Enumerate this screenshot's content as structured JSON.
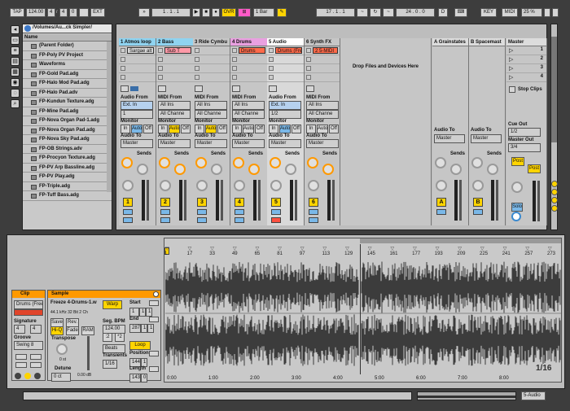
{
  "transport": {
    "tap": "TAP",
    "tempo": "124.00",
    "sig_num": "4",
    "sig_den": "4",
    "metro": "0",
    "ext": "EXT",
    "position": "1 . 1 . 1",
    "ovr": "OVR",
    "quant": "1 Bar",
    "loop_start": "17 . 1 . 1",
    "loop_len": "24 . 0 . 0",
    "key": "KEY",
    "midi": "MIDI",
    "cpu": "25 %",
    "draw_label": "D"
  },
  "browser": {
    "path": "/Volumes/Au...ck Simpler/",
    "column_header": "Name",
    "items": [
      "(Parent Folder)",
      "FP-Poly PV Project",
      "Waveforms",
      "FP-Gold Pad.adg",
      "FP-Halo Mod Pad.adg",
      "FP-Halo Pad.adv",
      "FP-Kundun Texture.adg",
      "FP-Mine Pad.adg",
      "FP-Nova Organ Pad-1.adg",
      "FP-Nova Organ Pad.adg",
      "FP-Nova Sky Pad.adg",
      "FP-OB Strings.adv",
      "FP-Procyon Texture.adg",
      "FP-PV Arp Bassline.adg",
      "FP-PV Play.adg",
      "FP-Triple.adg",
      "FP-Tuff Bass.adg"
    ]
  },
  "tracks": [
    {
      "name": "1 Atmos loop",
      "color": "#8fd3f0",
      "clip": "Sargae alt",
      "clip_color": "#d8d8d8",
      "from_label": "Audio From",
      "from": "Ext. In",
      "sub": "1",
      "to": "Master",
      "num": "1"
    },
    {
      "name": "2 Bass",
      "color": "#8fd3f0",
      "clip": "Sub T",
      "clip_color": "#ff9aa8",
      "from_label": "MIDI From",
      "from": "All Ins",
      "sub": "All Channe",
      "to": "Master",
      "num": "2"
    },
    {
      "name": "3 Ride Cymbu",
      "color": "#c6c6c6",
      "clip": "",
      "clip_color": "",
      "from_label": "MIDI From",
      "from": "All Ins",
      "sub": "All Channe",
      "to": "Master",
      "num": "3"
    },
    {
      "name": "4 Drums",
      "color": "#e9a0e0",
      "clip": "Drums",
      "clip_color": "#ff6a4a",
      "from_label": "MIDI From",
      "from": "All Ins",
      "sub": "All Channe",
      "to": "Master",
      "num": "4"
    },
    {
      "name": "5 Audio",
      "color": "#ffffff",
      "clip": "Drums (Free",
      "clip_color": "#ff6a4a",
      "from_label": "Audio From",
      "from": "Ext. In",
      "sub": "1/2",
      "to": "Master",
      "num": "5"
    },
    {
      "name": "6 Synth FX",
      "color": "#c6c6c6",
      "clip": "2 5-MIDI",
      "clip_color": "#ff6a4a",
      "from_label": "MIDI From",
      "from": "All Ins",
      "sub": "All Channe",
      "to": "Master",
      "num": "6"
    }
  ],
  "drop_area": "Drop Files and Devices Here",
  "returns": [
    {
      "name": "A Grainstates",
      "to": "Master",
      "btn": "A"
    },
    {
      "name": "B Spacemast",
      "to": "Master",
      "btn": "B"
    }
  ],
  "master": {
    "name": "Master",
    "scenes": [
      "1",
      "2",
      "3",
      "4"
    ],
    "stop_clips": "Stop Clips",
    "cue_out_label": "Cue Out",
    "cue_out": "1/2",
    "master_out_label": "Master Out",
    "master_out": "3/4",
    "post1": "Post",
    "post2": "Post",
    "solo": "Solo"
  },
  "io_labels": {
    "monitor": "Monitor",
    "in": "In",
    "auto": "Auto",
    "off": "Off",
    "audio_to": "Audio To",
    "sends": "Sends"
  },
  "clip_view": {
    "clip_tab": "Clip",
    "clip_name": "Drums (Free",
    "signature_label": "Signature",
    "sig_num": "4",
    "sig_den": "4",
    "groove_label": "Groove",
    "groove": "Swing 8",
    "sample_tab": "Sample",
    "sample_name": "Freeze 4-Drums-1.w",
    "sample_info": "44.1 kHz 32 Bit 2 Ch",
    "save": "Save",
    "rev": "Rev.",
    "hiq": "Hi-Q",
    "fade": "Fade",
    "ram": "RAM",
    "transpose_label": "Transpose",
    "transpose": "0 st",
    "detune_label": "Detune",
    "detune": "0 ct",
    "gain": "0.00 dB",
    "warp": "Warp",
    "seg_bpm_label": "Seg. BPM",
    "seg_bpm": "124.00",
    "half": ":2",
    "double": "*2",
    "warp_mode": "Beats",
    "transients_label": "Transients",
    "transients": "1/16",
    "start_label": "Start",
    "start": [
      "1",
      "1",
      "1"
    ],
    "end_label": "End",
    "end": [
      "287",
      "1",
      "1"
    ],
    "loop": "Loop",
    "position_label": "Position",
    "position": [
      "144",
      "1"
    ],
    "length_label": "Length",
    "length": [
      "143",
      "0"
    ]
  },
  "ruler": {
    "top": [
      "1",
      "17",
      "33",
      "49",
      "65",
      "81",
      "97",
      "113",
      "129",
      "145",
      "161",
      "177",
      "193",
      "209",
      "225",
      "241",
      "257",
      "273"
    ],
    "bottom": [
      "0:00",
      "1:00",
      "2:00",
      "3:00",
      "4:00",
      "5:00",
      "6:00",
      "7:00",
      "8:00"
    ],
    "zoom": "1/16"
  },
  "status": {
    "track": "5-Audio"
  }
}
